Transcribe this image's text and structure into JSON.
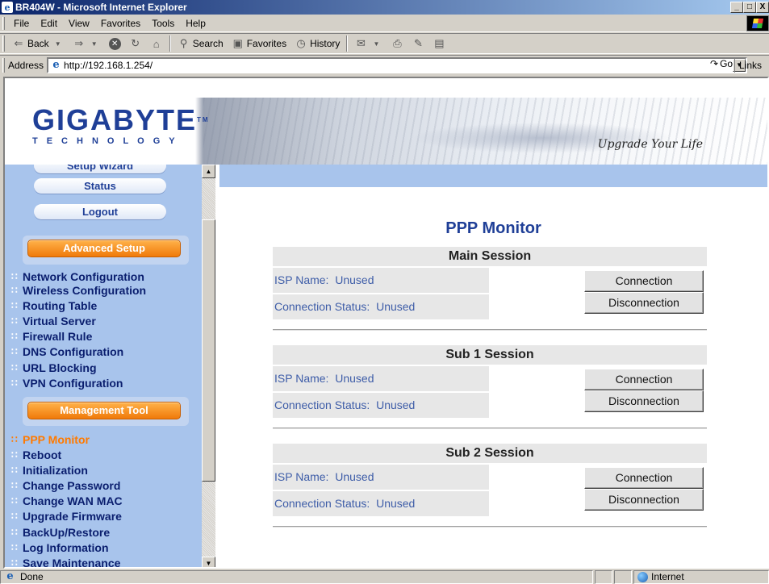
{
  "window": {
    "title": "BR404W - Microsoft Internet Explorer",
    "buttons": [
      "_",
      "□",
      "X"
    ]
  },
  "menubar": {
    "items": [
      "File",
      "Edit",
      "View",
      "Favorites",
      "Tools",
      "Help"
    ]
  },
  "toolbar": {
    "back": "Back",
    "search": "Search",
    "favorites": "Favorites",
    "history": "History"
  },
  "address": {
    "label": "Address",
    "url": "http://192.168.1.254/",
    "go": "Go",
    "links": "Links"
  },
  "brand": {
    "logo": "GIGABYTE",
    "tm": "TM",
    "sub": "TECHNOLOGY",
    "slogan": "Upgrade Your Life"
  },
  "sidebar": {
    "pills": [
      "Setup Wizard",
      "Status",
      "Logout"
    ],
    "sections": [
      {
        "title": "Advanced Setup",
        "items": [
          "Network Configuration",
          "Wireless Configuration",
          "Routing Table",
          "Virtual Server",
          "Firewall Rule",
          "DNS Configuration",
          "URL Blocking",
          "VPN Configuration"
        ]
      },
      {
        "title": "Management Tool",
        "items": [
          "PPP Monitor",
          "Reboot",
          "Initialization",
          "Change Password",
          "Change WAN MAC",
          "Upgrade Firmware",
          "BackUp/Restore",
          "Log Information",
          "Save Maintenance"
        ]
      }
    ],
    "active_item": "PPP Monitor"
  },
  "main": {
    "title": "PPP Monitor",
    "sessions": [
      {
        "name": "Main Session",
        "isp_label": "ISP Name:",
        "isp_value": "Unused",
        "status_label": "Connection Status:",
        "status_value": "Unused",
        "connect": "Connection",
        "disconnect": "Disconnection"
      },
      {
        "name": "Sub 1 Session",
        "isp_label": "ISP Name:",
        "isp_value": "Unused",
        "status_label": "Connection Status:",
        "status_value": "Unused",
        "connect": "Connection",
        "disconnect": "Disconnection"
      },
      {
        "name": "Sub 2 Session",
        "isp_label": "ISP Name:",
        "isp_value": "Unused",
        "status_label": "Connection Status:",
        "status_value": "Unused",
        "connect": "Connection",
        "disconnect": "Disconnection"
      }
    ]
  },
  "statusbar": {
    "text": "Done",
    "zone": "Internet"
  },
  "colors": {
    "brand_blue": "#1f3f97",
    "sidebar_bg": "#a8c4ec",
    "accent_orange": "#f07a0a",
    "active_item": "#ff7a00"
  }
}
